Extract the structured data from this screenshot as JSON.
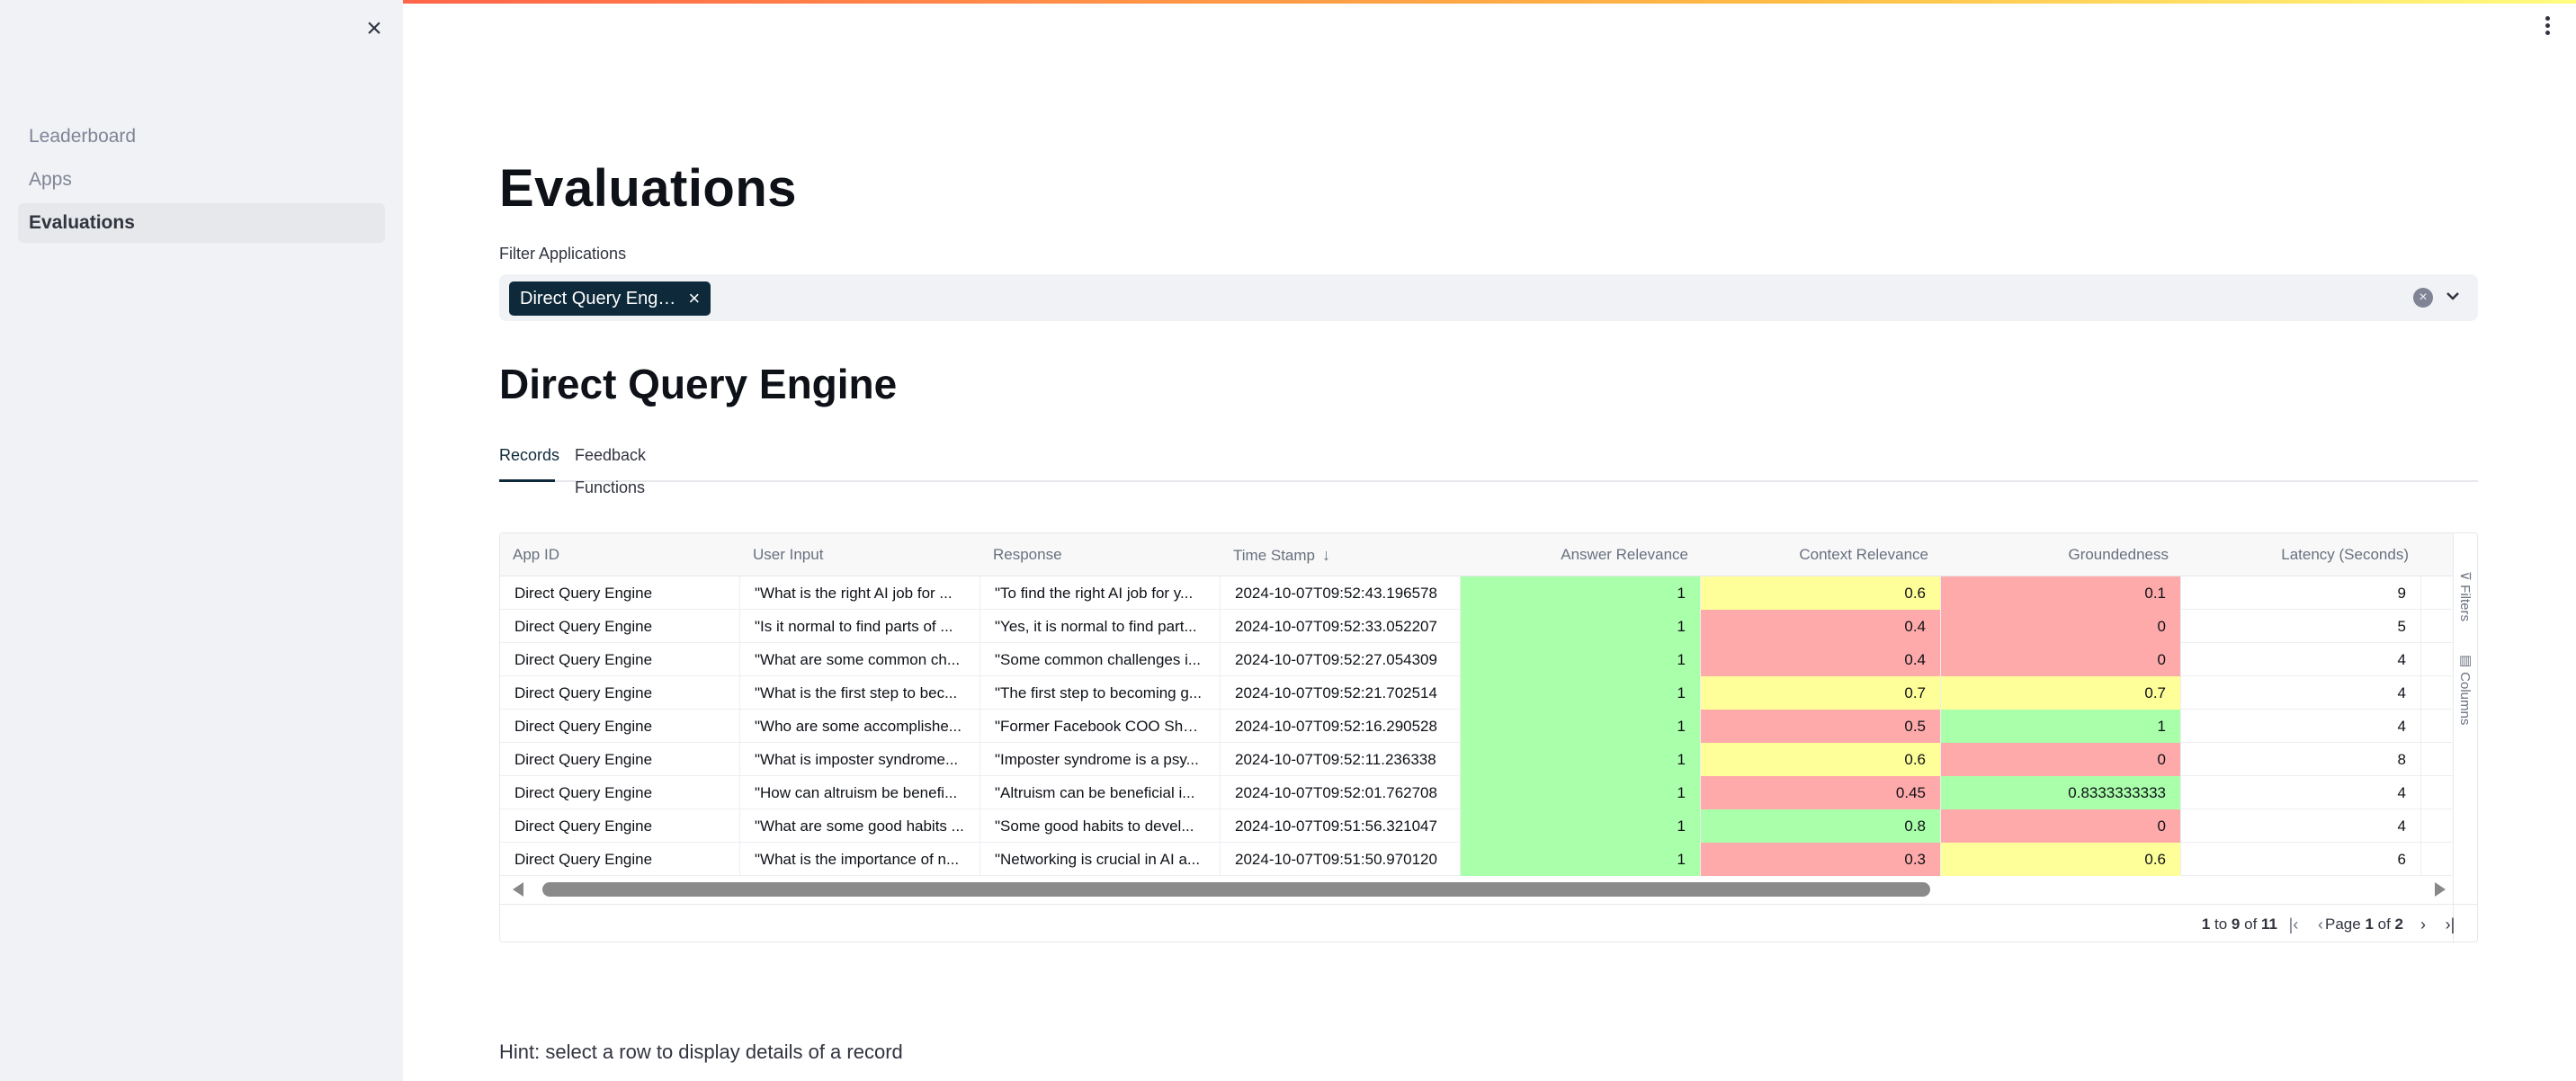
{
  "colors": {
    "cell_green": "#aaffaa",
    "cell_yellow": "#ffff99",
    "cell_red": "#ffaaaa",
    "chip_bg": "#0e2a3a"
  },
  "sidebar": {
    "close_icon": "close-icon",
    "items": [
      {
        "label": "Leaderboard",
        "active": false
      },
      {
        "label": "Apps",
        "active": false
      },
      {
        "label": "Evaluations",
        "active": true
      }
    ]
  },
  "main_menu_icon": "vertical-ellipsis-icon",
  "page": {
    "title": "Evaluations",
    "filter_label": "Filter Applications",
    "filter_chip": "Direct Query Eng…",
    "section_title": "Direct Query Engine",
    "tabs": [
      {
        "label": "Records",
        "active": true
      },
      {
        "label": "Feedback Functions",
        "active": false
      }
    ],
    "hint": "Hint: select a row to display details of a record"
  },
  "table": {
    "columns": [
      "App ID",
      "User Input",
      "Response",
      "Time Stamp",
      "Answer Relevance",
      "Context Relevance",
      "Groundedness",
      "Latency (Seconds)"
    ],
    "sorted_column": "Time Stamp",
    "sort_direction": "descending",
    "rows": [
      {
        "app": "Direct Query Engine",
        "input": "\"What is the right AI job for ...",
        "response": "\"To find the right AI job for y...",
        "ts": "2024-10-07T09:52:43.196578",
        "ar": "1",
        "cr": "0.6",
        "gr": "0.1",
        "lat": "9"
      },
      {
        "app": "Direct Query Engine",
        "input": "\"Is it normal to find parts of ...",
        "response": "\"Yes, it is normal to find part...",
        "ts": "2024-10-07T09:52:33.052207",
        "ar": "1",
        "cr": "0.4",
        "gr": "0",
        "lat": "5"
      },
      {
        "app": "Direct Query Engine",
        "input": "\"What are some common ch...",
        "response": "\"Some common challenges i...",
        "ts": "2024-10-07T09:52:27.054309",
        "ar": "1",
        "cr": "0.4",
        "gr": "0",
        "lat": "4"
      },
      {
        "app": "Direct Query Engine",
        "input": "\"What is the first step to bec...",
        "response": "\"The first step to becoming g...",
        "ts": "2024-10-07T09:52:21.702514",
        "ar": "1",
        "cr": "0.7",
        "gr": "0.7",
        "lat": "4"
      },
      {
        "app": "Direct Query Engine",
        "input": "\"Who are some accomplishe...",
        "response": "\"Former Facebook COO Sher...",
        "ts": "2024-10-07T09:52:16.290528",
        "ar": "1",
        "cr": "0.5",
        "gr": "1",
        "lat": "4"
      },
      {
        "app": "Direct Query Engine",
        "input": "\"What is imposter syndrome...",
        "response": "\"Imposter syndrome is a psy...",
        "ts": "2024-10-07T09:52:11.236338",
        "ar": "1",
        "cr": "0.6",
        "gr": "0",
        "lat": "8"
      },
      {
        "app": "Direct Query Engine",
        "input": "\"How can altruism be benefi...",
        "response": "\"Altruism can be beneficial i...",
        "ts": "2024-10-07T09:52:01.762708",
        "ar": "1",
        "cr": "0.45",
        "gr": "0.8333333333",
        "lat": "4"
      },
      {
        "app": "Direct Query Engine",
        "input": "\"What are some good habits ...",
        "response": "\"Some good habits to devel...",
        "ts": "2024-10-07T09:51:56.321047",
        "ar": "1",
        "cr": "0.8",
        "gr": "0",
        "lat": "4"
      },
      {
        "app": "Direct Query Engine",
        "input": "\"What is the importance of n...",
        "response": "\"Networking is crucial in AI a...",
        "ts": "2024-10-07T09:51:50.970120",
        "ar": "1",
        "cr": "0.3",
        "gr": "0.6",
        "lat": "6"
      }
    ],
    "side_tabs": [
      "Filters",
      "Columns"
    ],
    "pagination": {
      "from": "1",
      "to": "9",
      "total": "11",
      "page": "1",
      "pages": "2"
    }
  }
}
